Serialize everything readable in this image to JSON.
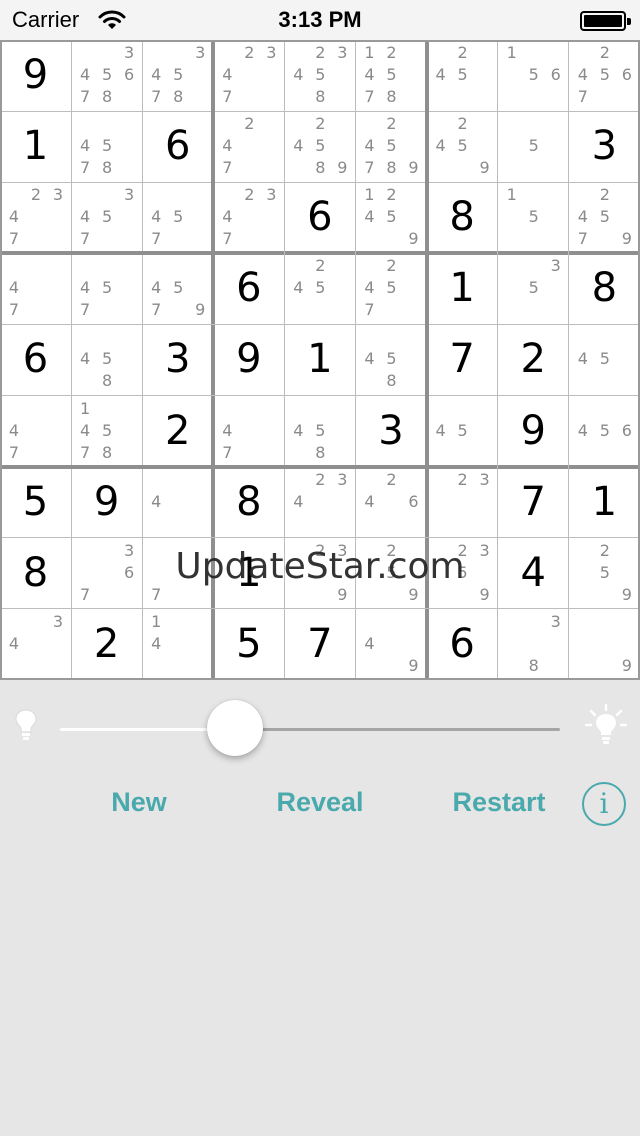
{
  "status_bar": {
    "carrier": "Carrier",
    "time": "3:13 PM"
  },
  "watermark": "UpdateStar.com",
  "controls": {
    "new_label": "New",
    "reveal_label": "Reveal",
    "restart_label": "Restart",
    "hint_level": 0.36
  },
  "theme": {
    "accent": "#4aa9ac",
    "given": "#000000",
    "candidate": "#8a8a8a"
  },
  "icons": {
    "low_hint": "lightbulb-off-icon",
    "high_hint": "lightbulb-on-icon",
    "info": "info-icon",
    "wifi": "wifi-icon",
    "battery": "battery-icon"
  },
  "grid": [
    [
      {
        "v": "9"
      },
      {
        "c": "345678"
      },
      {
        "c": "34578"
      },
      {
        "c": "2347"
      },
      {
        "c": "23458"
      },
      {
        "c": "124578"
      },
      {
        "c": "245"
      },
      {
        "c": "156"
      },
      {
        "c": "24567"
      }
    ],
    [
      {
        "v": "1"
      },
      {
        "c": "4578"
      },
      {
        "v": "6"
      },
      {
        "c": "247"
      },
      {
        "c": "24589"
      },
      {
        "c": "245789"
      },
      {
        "c": "2459"
      },
      {
        "c": "5"
      },
      {
        "v": "3"
      }
    ],
    [
      {
        "c": "2347"
      },
      {
        "c": "3457"
      },
      {
        "c": "457"
      },
      {
        "c": "2347"
      },
      {
        "v": "6"
      },
      {
        "c": "12459"
      },
      {
        "v": "8"
      },
      {
        "c": "15"
      },
      {
        "c": "24579"
      }
    ],
    [
      {
        "c": "47"
      },
      {
        "c": "457"
      },
      {
        "c": "4579"
      },
      {
        "v": "6"
      },
      {
        "c": "245"
      },
      {
        "c": "2457"
      },
      {
        "v": "1"
      },
      {
        "c": "35"
      },
      {
        "v": "8"
      }
    ],
    [
      {
        "v": "6"
      },
      {
        "c": "458"
      },
      {
        "v": "3"
      },
      {
        "v": "9"
      },
      {
        "v": "1"
      },
      {
        "c": "458"
      },
      {
        "v": "7"
      },
      {
        "v": "2"
      },
      {
        "c": "45"
      }
    ],
    [
      {
        "c": "47"
      },
      {
        "c": "14578"
      },
      {
        "v": "2"
      },
      {
        "c": "47"
      },
      {
        "c": "458"
      },
      {
        "v": "3"
      },
      {
        "c": "45"
      },
      {
        "v": "9"
      },
      {
        "c": "456"
      }
    ],
    [
      {
        "v": "5"
      },
      {
        "v": "9"
      },
      {
        "c": "4"
      },
      {
        "v": "8"
      },
      {
        "c": "234"
      },
      {
        "c": "246"
      },
      {
        "c": "23"
      },
      {
        "v": "7"
      },
      {
        "v": "1"
      }
    ],
    [
      {
        "v": "8"
      },
      {
        "c": "367"
      },
      {
        "c": "7"
      },
      {
        "v": "1"
      },
      {
        "c": "239"
      },
      {
        "c": "259"
      },
      {
        "c": "2359"
      },
      {
        "v": "4"
      },
      {
        "c": "259"
      }
    ],
    [
      {
        "c": "34"
      },
      {
        "v": "2"
      },
      {
        "c": "14"
      },
      {
        "v": "5"
      },
      {
        "v": "7"
      },
      {
        "c": "49"
      },
      {
        "v": "6"
      },
      {
        "c": "38"
      },
      {
        "c": "9"
      }
    ]
  ]
}
